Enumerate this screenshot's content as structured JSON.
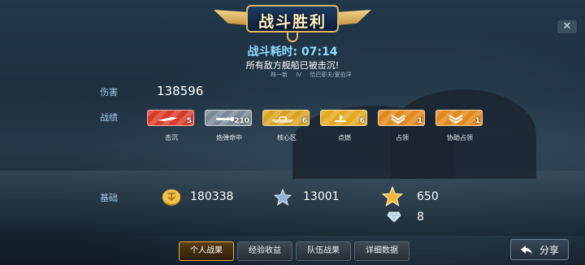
{
  "header": {
    "title": "战斗胜利",
    "battle_time": "战斗耗时: 07:14",
    "result_message": "所有敌方舰船已被击沉!",
    "players": [
      "林一新",
      "IV",
      "恰巴耶夫/夏伯洋"
    ]
  },
  "damage": {
    "label": "伤害",
    "value": "138596"
  },
  "achievements": {
    "label": "战绩",
    "medals": [
      {
        "name": "击沉",
        "count": "5",
        "color": "#d83a2a",
        "icon": "plane-sink-icon"
      },
      {
        "name": "炮弹命中",
        "count": "210",
        "color": "#7a8a9a",
        "icon": "shell-hit-icon"
      },
      {
        "name": "核心区",
        "count": "6",
        "color": "#d8a323",
        "icon": "citadel-icon"
      },
      {
        "name": "点燃",
        "count": "6",
        "color": "#e3a91e",
        "icon": "fire-icon"
      },
      {
        "name": "占领",
        "count": "1",
        "color": "#e2891d",
        "icon": "capture-icon"
      },
      {
        "name": "协助占领",
        "count": "1",
        "color": "#e2891d",
        "icon": "assist-capture-icon"
      }
    ]
  },
  "base": {
    "label": "基础",
    "credits": "180338",
    "xp": "13001",
    "stars": "650",
    "diamonds": "8"
  },
  "tabs": [
    "个人战果",
    "经验收益",
    "队伍战果",
    "详细数据"
  ],
  "active_tab": 0,
  "share_label": "分享",
  "close_label": "✕"
}
